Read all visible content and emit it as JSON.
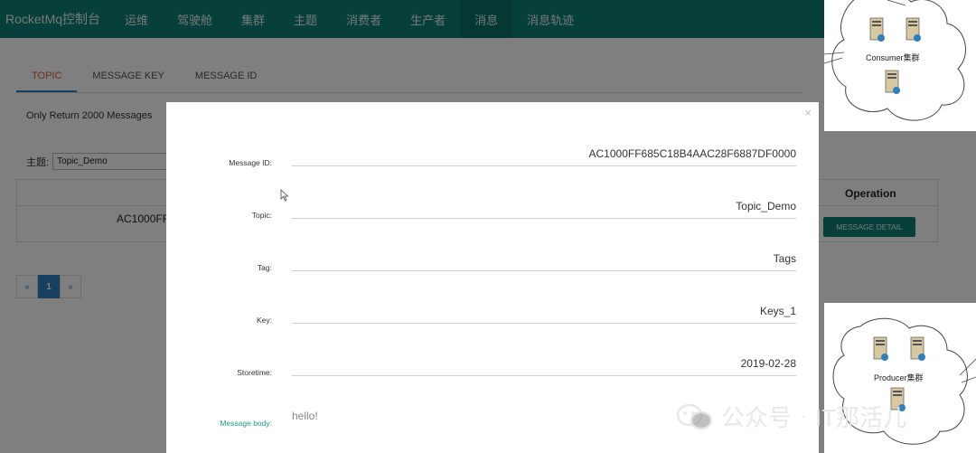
{
  "navbar": {
    "brand": "RocketMq控制台",
    "items": [
      "运维",
      "驾驶舱",
      "集群",
      "主题",
      "消费者",
      "生产者",
      "消息",
      "消息轨迹"
    ],
    "active_index": 6
  },
  "tabs": [
    "TOPIC",
    "MESSAGE KEY",
    "MESSAGE ID"
  ],
  "note": "Only Return 2000 Messages",
  "topic_filter": {
    "label": "主题:",
    "value": "Topic_Demo"
  },
  "table": {
    "op_header": "Operation",
    "row_id": "AC1000FF",
    "detail_button": "MESSAGE DETAIL"
  },
  "pager": {
    "prev": "«",
    "current": "1",
    "next": "»"
  },
  "modal": {
    "close": "×",
    "fields": [
      {
        "label": "Message ID:",
        "value": "AC1000FF685C18B4AAC28F6887DF0000"
      },
      {
        "label": "Topic:",
        "value": "Topic_Demo"
      },
      {
        "label": "Tag:",
        "value": "Tags"
      },
      {
        "label": "Key:",
        "value": "Keys_1"
      },
      {
        "label": "Storetime:",
        "value": "2019-02-28"
      }
    ],
    "body_label": "Message body:",
    "body_value": "hello!"
  },
  "diagram": {
    "consumer_label": "Consumer集群",
    "producer_label": "Producer集群"
  },
  "watermark": {
    "left": "公众号",
    "dot": "·",
    "right": "IT那活儿"
  },
  "colors": {
    "primary": "#0f7f76",
    "accent_tab": "#e05a3a",
    "body_label": "#1a9c8d"
  }
}
